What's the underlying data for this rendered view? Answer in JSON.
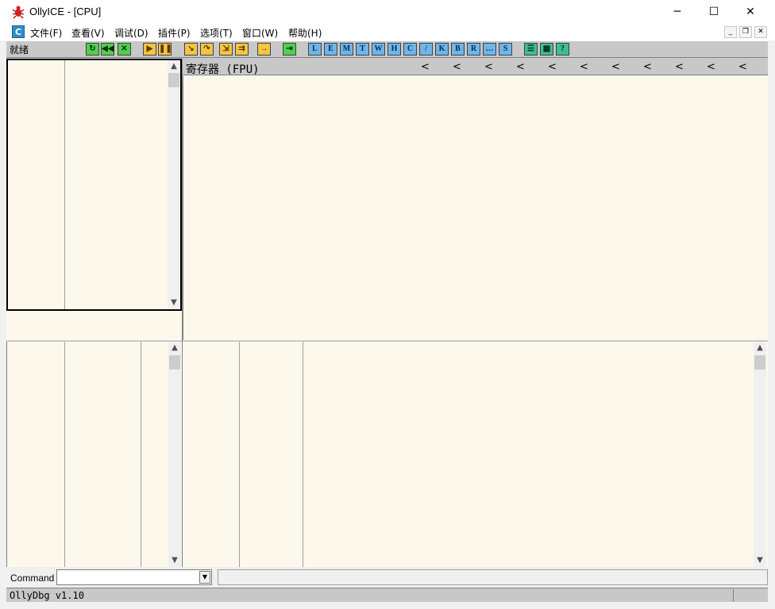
{
  "window": {
    "title": "OllyICE - [CPU]",
    "minimize_label": "─",
    "maximize_label": "☐",
    "close_label": "✕"
  },
  "menu": {
    "app_icon_label": "C",
    "items": [
      {
        "label": "文件(F)"
      },
      {
        "label": "查看(V)"
      },
      {
        "label": "调试(D)"
      },
      {
        "label": "插件(P)"
      },
      {
        "label": "选项(T)"
      },
      {
        "label": "窗口(W)"
      },
      {
        "label": "帮助(H)"
      }
    ],
    "mdi_min": "_",
    "mdi_restore": "❐",
    "mdi_close": "✕"
  },
  "toolbar": {
    "status": "就绪",
    "buttons": [
      {
        "name": "open",
        "label": "↻"
      },
      {
        "name": "restart",
        "label": "◀◀"
      },
      {
        "name": "close",
        "label": "✕"
      },
      {
        "name": "run",
        "label": "▶"
      },
      {
        "name": "pause",
        "label": "❚❚"
      },
      {
        "name": "step-into",
        "label": "↘"
      },
      {
        "name": "step-over",
        "label": "↷"
      },
      {
        "name": "trace-into",
        "label": "⇲"
      },
      {
        "name": "trace-over",
        "label": "⇉"
      },
      {
        "name": "execute-till-return",
        "label": "→"
      },
      {
        "name": "goto",
        "label": "⇥"
      },
      {
        "name": "log",
        "label": "L"
      },
      {
        "name": "executable-modules",
        "label": "E"
      },
      {
        "name": "memory-map",
        "label": "M"
      },
      {
        "name": "threads",
        "label": "T"
      },
      {
        "name": "windows",
        "label": "W"
      },
      {
        "name": "handles",
        "label": "H"
      },
      {
        "name": "cpu",
        "label": "C"
      },
      {
        "name": "patches",
        "label": "/"
      },
      {
        "name": "call-stack",
        "label": "K"
      },
      {
        "name": "breakpoints",
        "label": "B"
      },
      {
        "name": "references",
        "label": "R"
      },
      {
        "name": "run-trace",
        "label": "…"
      },
      {
        "name": "source",
        "label": "S"
      },
      {
        "name": "options",
        "label": "☰"
      },
      {
        "name": "appearance",
        "label": "▦"
      },
      {
        "name": "help",
        "label": "?"
      }
    ]
  },
  "registers": {
    "title": "寄存器 (FPU)",
    "chevron": "<"
  },
  "scroll": {
    "up": "▲",
    "down": "▼"
  },
  "command": {
    "label": "Command",
    "value": "",
    "dropdown_glyph": "▼"
  },
  "statusbar": {
    "text": "OllyDbg v1.10"
  }
}
